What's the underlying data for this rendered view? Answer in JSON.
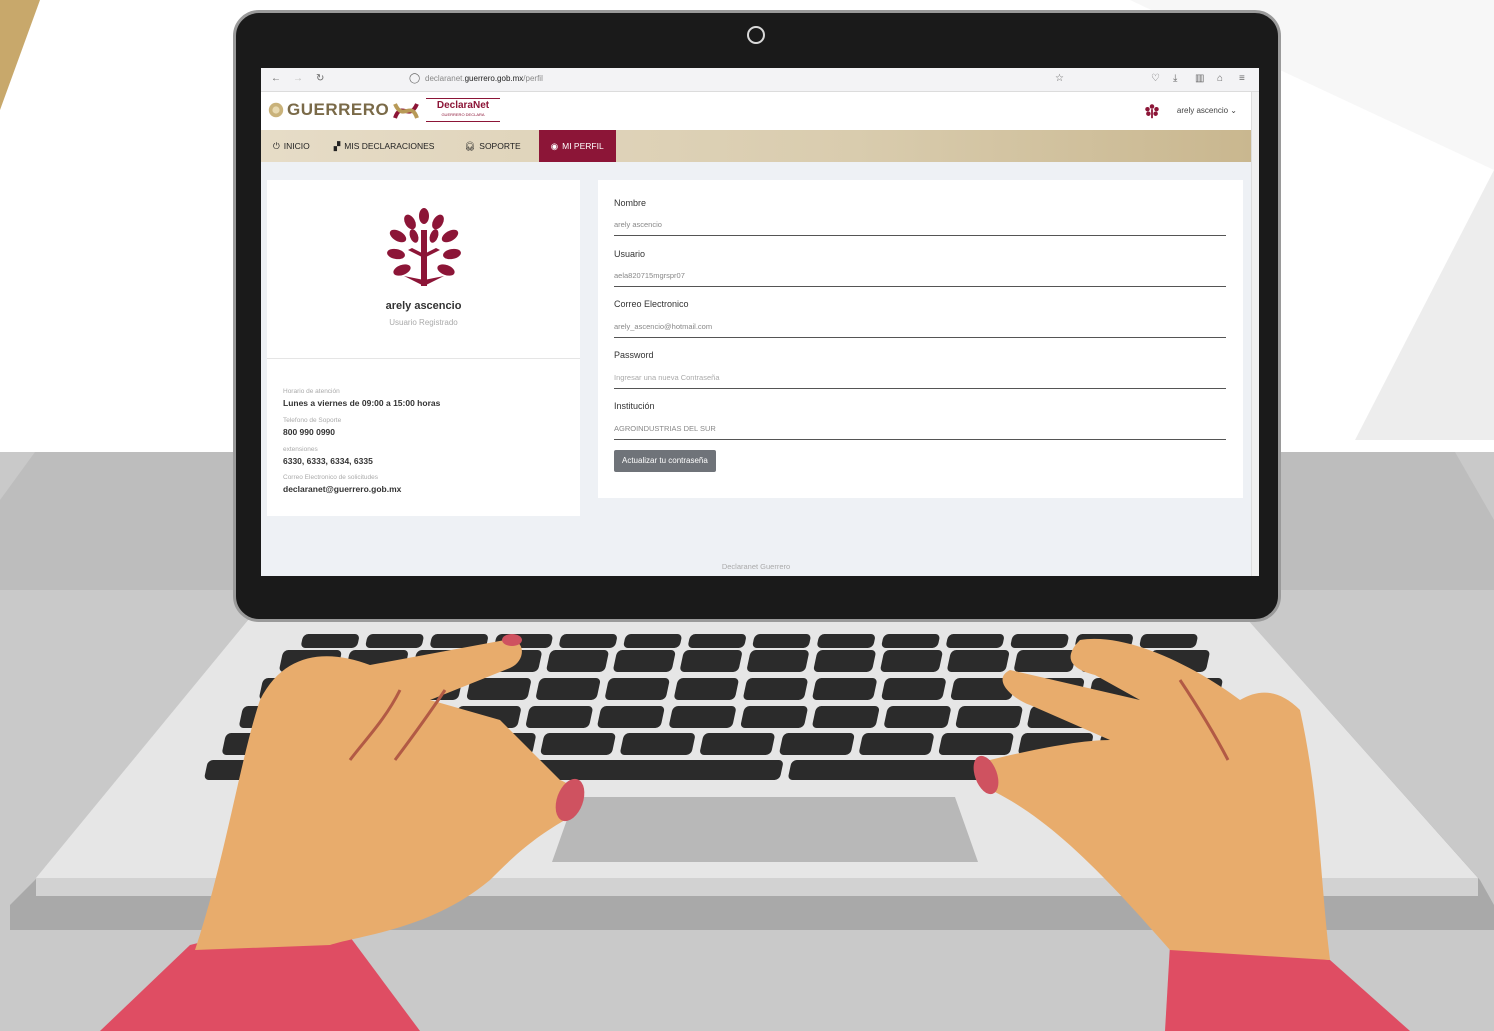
{
  "browser": {
    "url_prefix": "declaranet.",
    "url_domain": "guerrero.gob.mx",
    "url_path": "/perfil"
  },
  "header": {
    "state_name": "GUERRERO",
    "app_title": "DeclaraNet",
    "app_subtitle": "GUERRERO DECLARA",
    "user_menu": "arely ascencio"
  },
  "nav": {
    "items": [
      {
        "label": "INICIO",
        "icon": "power-icon"
      },
      {
        "label": "MIS DECLARACIONES",
        "icon": "boxes-icon"
      },
      {
        "label": "SOPORTE",
        "icon": "headset-icon"
      },
      {
        "label": "MI PERFIL",
        "icon": "user-circle-icon"
      }
    ]
  },
  "profile": {
    "name": "arely ascencio",
    "role": "Usuario Registrado"
  },
  "contact": {
    "hours_label": "Horario de atención",
    "hours_value": "Lunes a viernes de 09:00 a 15:00 horas",
    "phone_label": "Telefono de Soporte",
    "phone_value": "800 990 0990",
    "ext_label": "extensiones",
    "ext_value": "6330, 6333, 6334, 6335",
    "email_label": "Correo Electronico de solicitudes",
    "email_value": "declaranet@guerrero.gob.mx"
  },
  "form": {
    "nombre_label": "Nombre",
    "nombre_value": "arely ascencio",
    "usuario_label": "Usuario",
    "usuario_value": "aela820715mgrspr07",
    "correo_label": "Correo Electronico",
    "correo_value": "arely_ascencio@hotmail.com",
    "password_label": "Password",
    "password_placeholder": "Ingresar una nueva Contraseña",
    "institucion_label": "Institución",
    "institucion_value": "AGROINDUSTRIAS DEL SUR",
    "update_button": "Actualizar tu contraseña"
  },
  "footer": {
    "text": "Declaranet Guerrero"
  },
  "colors": {
    "brand": "#8c1537",
    "gold": "#d9ccae",
    "skin": "#e8ac6c",
    "sleeve": "#df4d63"
  }
}
